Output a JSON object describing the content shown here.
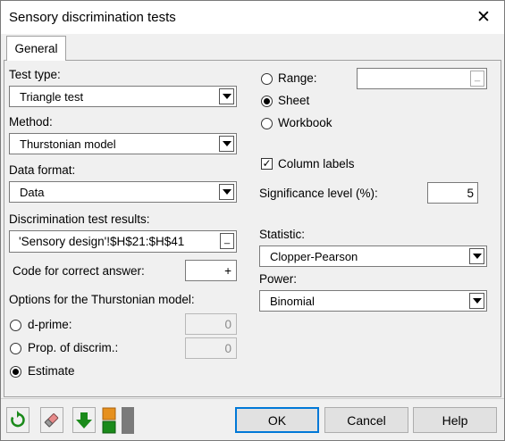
{
  "window": {
    "title": "Sensory discrimination tests",
    "close_glyph": "✕"
  },
  "tabs": [
    {
      "label": "General"
    }
  ],
  "left": {
    "test_type": {
      "label": "Test type:",
      "value": "Triangle test"
    },
    "method": {
      "label": "Method:",
      "value": "Thurstonian model"
    },
    "data_format": {
      "label": "Data format:",
      "value": "Data"
    },
    "results": {
      "label": "Discrimination test results:",
      "value": "'Sensory design'!$H$21:$H$41",
      "btn": "_"
    },
    "code": {
      "label": "Code for correct answer:",
      "value": "+"
    },
    "options_label": "Options for the Thurstonian model:",
    "dprime": {
      "label": "d-prime:",
      "value": "0",
      "checked": false
    },
    "prop": {
      "label": "Prop. of discrim.:",
      "value": "0",
      "checked": false
    },
    "estimate": {
      "label": "Estimate",
      "checked": true
    }
  },
  "right": {
    "range": {
      "label": "Range:",
      "value": "",
      "btn": "_",
      "checked": false
    },
    "sheet": {
      "label": "Sheet",
      "checked": true
    },
    "workbook": {
      "label": "Workbook",
      "checked": false
    },
    "column_labels": {
      "label": "Column labels",
      "checked": true,
      "mark": "✓"
    },
    "significance": {
      "label": "Significance level (%):",
      "value": "5"
    },
    "statistic": {
      "label": "Statistic:",
      "value": "Clopper-Pearson"
    },
    "power": {
      "label": "Power:",
      "value": "Binomial"
    }
  },
  "footer": {
    "ok": "OK",
    "cancel": "Cancel",
    "help": "Help",
    "icons": [
      "reset-icon",
      "eraser-icon",
      "down-arrow-icon",
      "layout-icon"
    ]
  },
  "colors": {
    "accent": "#0078d7",
    "green": "#1a8a1a",
    "orange": "#e6901e"
  }
}
